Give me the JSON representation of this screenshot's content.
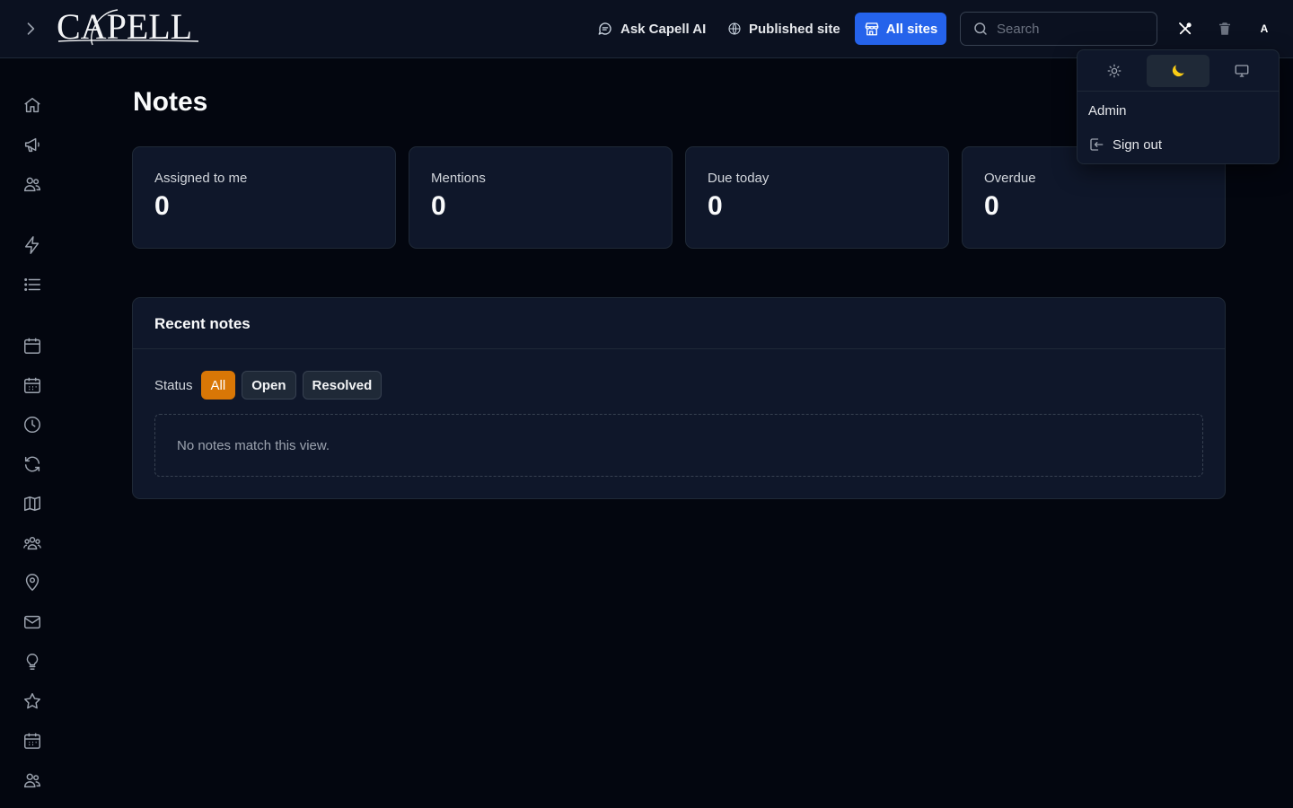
{
  "header": {
    "logo_text": "CAPELL",
    "ask_ai_label": "Ask Capell AI",
    "published_site_label": "Published site",
    "all_sites_label": "All sites",
    "search_placeholder": "Search",
    "avatar_initial": "A",
    "accent_color": "#2563eb"
  },
  "sidebar": {
    "items": [
      {
        "icon": "home-icon"
      },
      {
        "icon": "megaphone-icon"
      },
      {
        "icon": "users-icon"
      },
      {
        "icon": "bolt-icon"
      },
      {
        "icon": "list-icon"
      },
      {
        "icon": "calendar-icon"
      },
      {
        "icon": "calendar-grid-icon"
      },
      {
        "icon": "clock-icon"
      },
      {
        "icon": "refresh-icon"
      },
      {
        "icon": "map-icon"
      },
      {
        "icon": "user-group-icon"
      },
      {
        "icon": "map-pin-icon"
      },
      {
        "icon": "mail-icon"
      },
      {
        "icon": "lightbulb-icon"
      },
      {
        "icon": "star-icon"
      },
      {
        "icon": "calendar-grid-icon"
      },
      {
        "icon": "users-icon"
      }
    ]
  },
  "page": {
    "title": "Notes",
    "stats": [
      {
        "label": "Assigned to me",
        "value": "0"
      },
      {
        "label": "Mentions",
        "value": "0"
      },
      {
        "label": "Due today",
        "value": "0"
      },
      {
        "label": "Overdue",
        "value": "0"
      }
    ],
    "recent": {
      "title": "Recent notes",
      "filter_label": "Status",
      "filters": [
        {
          "label": "All",
          "active": true
        },
        {
          "label": "Open",
          "active": false
        },
        {
          "label": "Resolved",
          "active": false
        }
      ],
      "empty_text": "No notes match this view.",
      "active_color": "#d97706"
    }
  },
  "menu": {
    "theme_options": [
      {
        "icon": "sun-icon",
        "active": false
      },
      {
        "icon": "moon-icon",
        "active": true
      },
      {
        "icon": "monitor-icon",
        "active": false
      }
    ],
    "user_name": "Admin",
    "sign_out_label": "Sign out"
  }
}
